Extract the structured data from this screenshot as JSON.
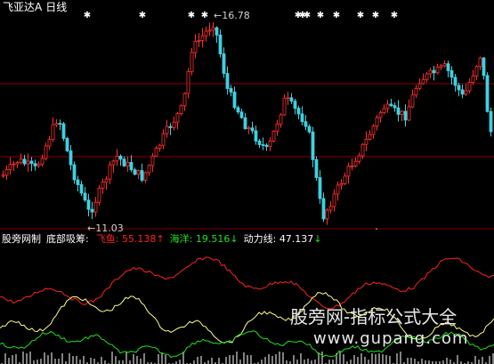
{
  "header": {
    "title": "飞亚达A",
    "period": "日线"
  },
  "price_panel": {
    "high_label": "16.78",
    "low_label": "11.03",
    "colors": {
      "up": "#ff3030",
      "down": "#40d0e0",
      "grid": "#8b0000",
      "marker": "#ffffff"
    }
  },
  "indicator": {
    "name": "股旁网制",
    "sub": "底部吸筹:",
    "feiyu_label": "飞鱼:",
    "feiyu_value": "55.138",
    "feiyu_arrow": "↑",
    "haiyang_label": "海洋:",
    "haiyang_value": "19.516",
    "haiyang_arrow": "↓",
    "dongli_label": "动力线:",
    "dongli_value": "47.137",
    "dongli_arrow": "↓",
    "colors": {
      "feiyu": "#ff2020",
      "haiyang": "#20e020",
      "dongli": "#ffff80",
      "bars": "#ffffff"
    }
  },
  "watermark": {
    "text": "股旁网-指标公式大全",
    "url": "www.gupang.com"
  }
}
